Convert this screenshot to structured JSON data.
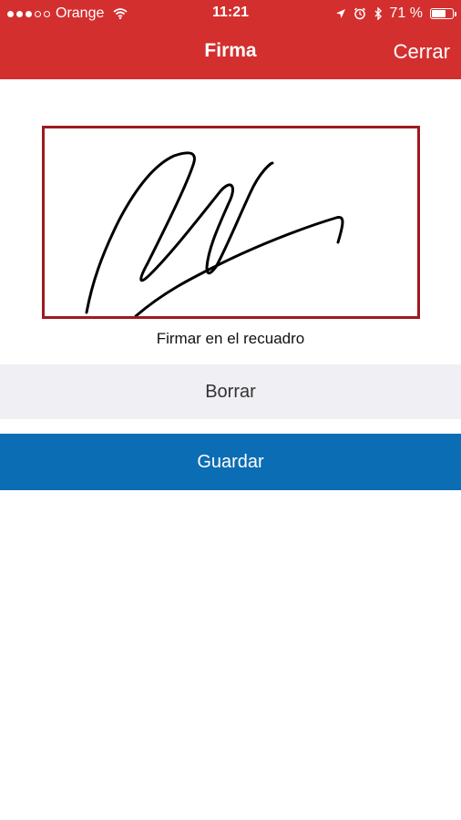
{
  "status_bar": {
    "carrier": "Orange",
    "time": "11:21",
    "battery_percent": "71 %",
    "battery_level": 0.71,
    "signal_bars_filled": 3,
    "signal_bars_total": 5
  },
  "nav": {
    "title": "Firma",
    "close_label": "Cerrar"
  },
  "signature": {
    "hint": "Firmar en el recuadro"
  },
  "actions": {
    "clear_label": "Borrar",
    "save_label": "Guardar"
  },
  "colors": {
    "header": "#d32f2f",
    "signature_border": "#9e1a1f",
    "save_button": "#0b6db4",
    "clear_button": "#efeff4"
  }
}
